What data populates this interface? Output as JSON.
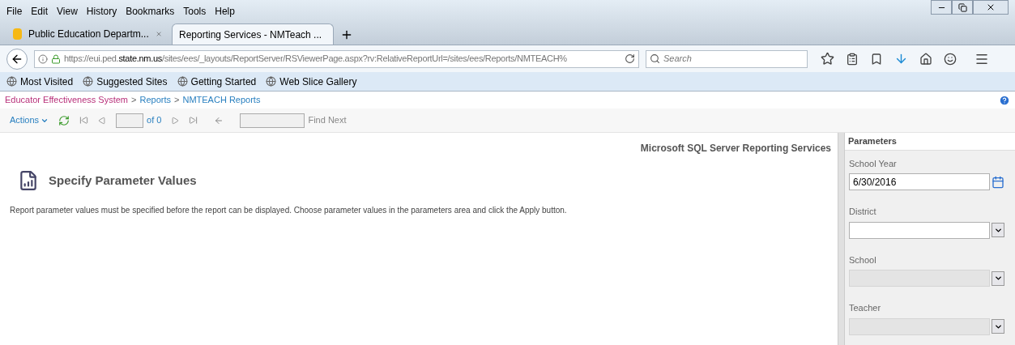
{
  "menu": [
    "File",
    "Edit",
    "View",
    "History",
    "Bookmarks",
    "Tools",
    "Help"
  ],
  "tabs": [
    {
      "label": "Public Education Departm...",
      "selected": false
    },
    {
      "label": "Reporting Services - NMTeach ...",
      "selected": true
    }
  ],
  "address": {
    "prefix": "https://eui.ped.",
    "host": "state.nm.us",
    "path": "/sites/ees/_layouts/ReportServer/RSViewerPage.aspx?rv:RelativeReportUrl=/sites/ees/Reports/NMTEACH%"
  },
  "search": {
    "placeholder": "Search"
  },
  "bookmarks": [
    "Most Visited",
    "Suggested Sites",
    "Getting Started",
    "Web Slice Gallery"
  ],
  "breadcrumb": [
    "Educator Effectiveness System",
    "Reports",
    "NMTEACH Reports"
  ],
  "breadcrumb_separator": ">",
  "toolbar": {
    "actions": "Actions",
    "page_of": "of 0",
    "find_next": "Find Next"
  },
  "report": {
    "brand": "Microsoft SQL Server Reporting Services",
    "title": "Specify Parameter Values",
    "message": "Report parameter values must be specified before the report can be displayed. Choose parameter values in the parameters area and click the Apply button."
  },
  "parameters": {
    "title": "Parameters",
    "fields": [
      {
        "label": "School Year",
        "kind": "date",
        "value": "6/30/2016",
        "disabled": false
      },
      {
        "label": "District",
        "kind": "select",
        "disabled": false
      },
      {
        "label": "School",
        "kind": "select",
        "disabled": true
      },
      {
        "label": "Teacher",
        "kind": "select",
        "disabled": true
      }
    ]
  }
}
